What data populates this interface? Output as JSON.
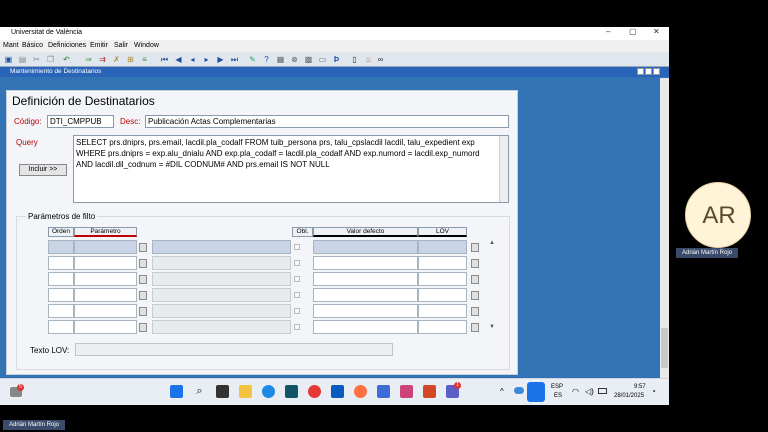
{
  "window": {
    "title": "Universitat de València",
    "minimize": "–",
    "maximize": "▢",
    "close": "✕"
  },
  "menu": [
    "Mant",
    "Básico",
    "Definiciones",
    "Emitir",
    "Salir",
    "Window"
  ],
  "subwindow_title": "Mantenimiento de Destinatarios",
  "form": {
    "heading": "Definición de Destinatarios",
    "codigo_label": "Código:",
    "codigo_value": "DTI_CMPPUB",
    "desc_label": "Desc:",
    "desc_value": "Publicación Actas Complementarias",
    "query_label": "Query",
    "query_value": "SELECT prs.dniprs, prs.email, lacdil.pla_codalf   FROM tuib_persona prs, talu_cpslacdil lacdil, talu_expedient exp   WHERE prs.dniprs = exp.alu_dnialu  AND exp.pla_codalf = lacdil.pla_codalf  AND exp.numord = lacdil.exp_numord  AND lacdil.dil_codnum = #DIL CODNUM#  AND prs.email IS NOT NULL",
    "incluir_button": "Incluir >>",
    "params_title": "Parámetros de filto",
    "col_orden": "Orden",
    "col_parametro": "Parámetro",
    "col_oblig": "Obl.",
    "col_valor": "Valor defecto",
    "col_lov": "LOV",
    "texto_lov_label": "Texto LOV:"
  },
  "taskbar": {
    "lang1": "ESP",
    "lang2": "ES",
    "time": "9:57",
    "date": "28/01/2025",
    "notif": "5",
    "badge": "1"
  },
  "participant": {
    "initials": "AR",
    "name": "Adrián Martín Rojo"
  },
  "presenter_name": "Adrián Martín Rojo"
}
